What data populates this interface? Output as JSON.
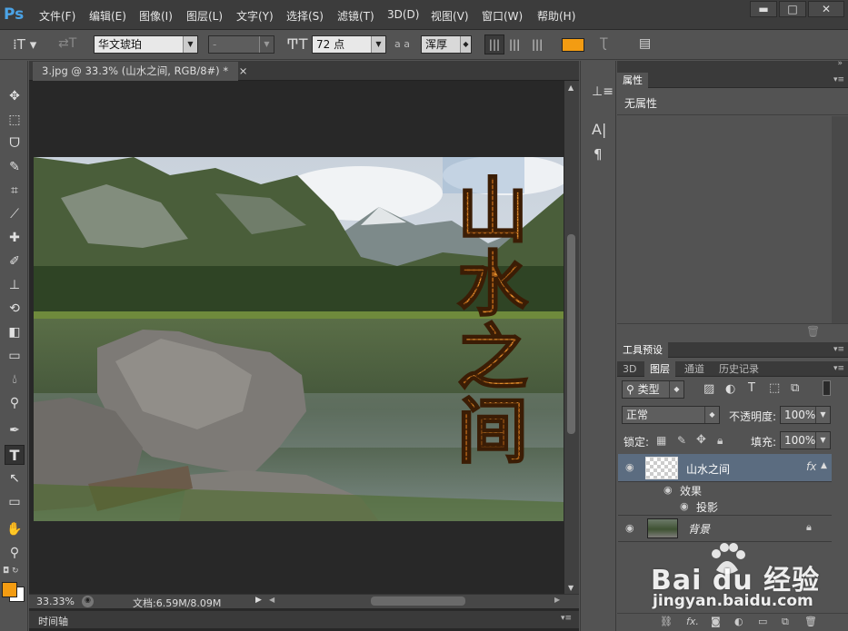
{
  "app": {
    "logo": "Ps"
  },
  "menu": [
    "文件(F)",
    "编辑(E)",
    "图像(I)",
    "图层(L)",
    "文字(Y)",
    "选择(S)",
    "滤镜(T)",
    "3D(D)",
    "视图(V)",
    "窗口(W)",
    "帮助(H)"
  ],
  "window_controls": {
    "minimize": "▬",
    "maximize": "□",
    "close": "✕"
  },
  "options": {
    "font_family": "华文琥珀",
    "font_style": "-",
    "font_size": "72 点",
    "aa_label": "a a",
    "antialias": "浑厚",
    "color_swatch": "#f39c12"
  },
  "document": {
    "tab_title": "3.jpg @ 33.3% (山水之间, RGB/8#) *",
    "tab_close": "×",
    "text_layer_chars": [
      "山",
      "水",
      "之",
      "间"
    ],
    "text_color": "#b5651d"
  },
  "status": {
    "zoom": "33.33%",
    "doc_info": "文档:6.59M/8.09M",
    "timeline": "时间轴"
  },
  "properties_panel": {
    "title": "属性",
    "content": "无属性"
  },
  "tool_presets_panel": {
    "title": "工具预设"
  },
  "layers_panel": {
    "tabs": [
      "3D",
      "图层",
      "通道",
      "历史记录"
    ],
    "active_tab": "图层",
    "filter_kind": "类型",
    "blend_mode": "正常",
    "opacity_label": "不透明度:",
    "opacity_value": "100%",
    "lock_label": "锁定:",
    "fill_label": "填充:",
    "fill_value": "100%",
    "layers": [
      {
        "name": "山水之间",
        "type": "text",
        "fx": "fx",
        "selected": true
      },
      {
        "name": "效果",
        "type": "effects"
      },
      {
        "name": "投影",
        "type": "effect"
      },
      {
        "name": "背景",
        "type": "background",
        "locked": true
      }
    ]
  },
  "watermark": {
    "brand": "Bai du 经验",
    "url": "jingyan.baidu.com"
  },
  "colors": {
    "foreground": "#f39c12",
    "background": "#ffffff",
    "accent": "#4ba3e6"
  }
}
